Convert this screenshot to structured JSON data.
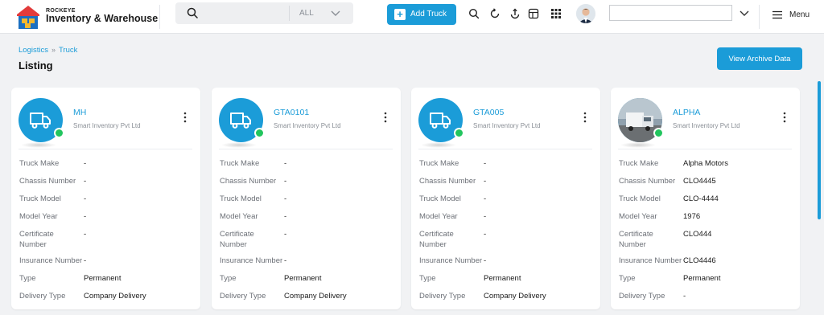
{
  "app": {
    "brand_small": "ROCKEYE",
    "brand_main": "Inventory & Warehouse"
  },
  "search": {
    "scope_value": "ALL"
  },
  "toolbar": {
    "add_truck_label": "Add Truck",
    "menu_label": "Menu"
  },
  "breadcrumb": [
    "Logistics",
    "Truck"
  ],
  "page": {
    "title": "Listing",
    "archive_label": "View Archive Data"
  },
  "colors": {
    "accent": "#1b9cd8",
    "online": "#22c55e"
  },
  "field_labels": {
    "make": "Truck Make",
    "chassis": "Chassis Number",
    "model": "Truck Model",
    "year": "Model Year",
    "certificate_line1": "Certificate",
    "certificate_line2": "Number",
    "insurance": "Insurance Number",
    "type": "Type",
    "delivery": "Delivery Type"
  },
  "trucks": [
    {
      "name": "MH",
      "company": "Smart Inventory Pvt Ltd",
      "avatar": "truck-icon",
      "make": "-",
      "chassis": "-",
      "model": "-",
      "year": "-",
      "certificate": "-",
      "insurance": "-",
      "type": "Permanent",
      "delivery": "Company Delivery"
    },
    {
      "name": "GTA0101",
      "company": "Smart Inventory Pvt Ltd",
      "avatar": "truck-icon",
      "make": "-",
      "chassis": "-",
      "model": "-",
      "year": "-",
      "certificate": "-",
      "insurance": "-",
      "type": "Permanent",
      "delivery": "Company Delivery"
    },
    {
      "name": "GTA005",
      "company": "Smart Inventory Pvt Ltd",
      "avatar": "truck-icon",
      "make": "-",
      "chassis": "-",
      "model": "-",
      "year": "-",
      "certificate": "-",
      "insurance": "-",
      "type": "Permanent",
      "delivery": "Company Delivery"
    },
    {
      "name": "ALPHA",
      "company": "Smart Inventory Pvt Ltd",
      "avatar": "truck-photo",
      "make": "Alpha Motors",
      "chassis": "CLO4445",
      "model": "CLO-4444",
      "year": "1976",
      "certificate": "CLO444",
      "insurance": "CLO4446",
      "type": "Permanent",
      "delivery": "-"
    }
  ]
}
